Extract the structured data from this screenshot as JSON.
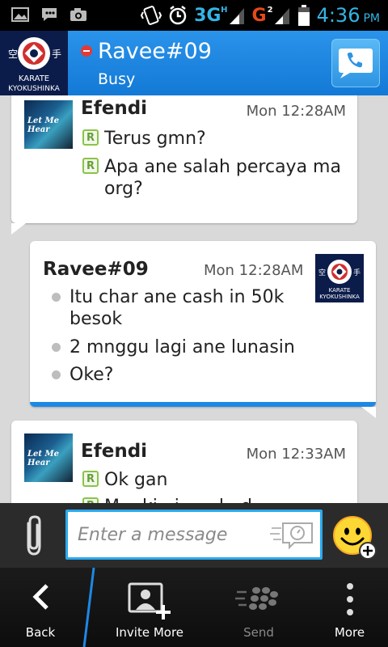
{
  "status_bar": {
    "network_3g": "3G",
    "network_3g_sup": "H",
    "network_g": "G",
    "network_g_sup": "2",
    "time": "4:36",
    "ampm": "PM",
    "icons": [
      "gallery-icon",
      "bbm-notification-icon",
      "camera-icon",
      "vibrate-icon",
      "alarm-icon",
      "signal-icon",
      "battery-icon"
    ]
  },
  "header": {
    "contact_name": "Ravee#09",
    "status": "Busy",
    "status_color": "#e53935",
    "accent_color": "#1e88e5",
    "avatar_text_line1": "KARATE",
    "avatar_text_line2": "KYOKUSHINKA"
  },
  "messages": [
    {
      "sender": "Efendi",
      "time": "Mon 12:28AM",
      "avatar_text": "Let Me Hear",
      "lines": [
        "Terus gmn?",
        "Apa ane salah percaya ma",
        "org?"
      ]
    },
    {
      "sender": "Ravee#09",
      "time": "Mon 12:28AM",
      "lines": [
        "Itu char ane cash in 50k",
        "besok",
        "2 mnggu lagi ane lunasin",
        "Oke?"
      ]
    },
    {
      "sender": "Efendi",
      "time": "Mon 12:33AM",
      "avatar_text": "Let Me Hear",
      "lines": [
        "Ok gan",
        "M... ki...i... ...l...d... ...."
      ]
    }
  ],
  "read_badge": "R",
  "composer": {
    "placeholder": "Enter a message"
  },
  "action_bar": {
    "back": "Back",
    "invite_more": "Invite More",
    "send": "Send",
    "more": "More"
  }
}
